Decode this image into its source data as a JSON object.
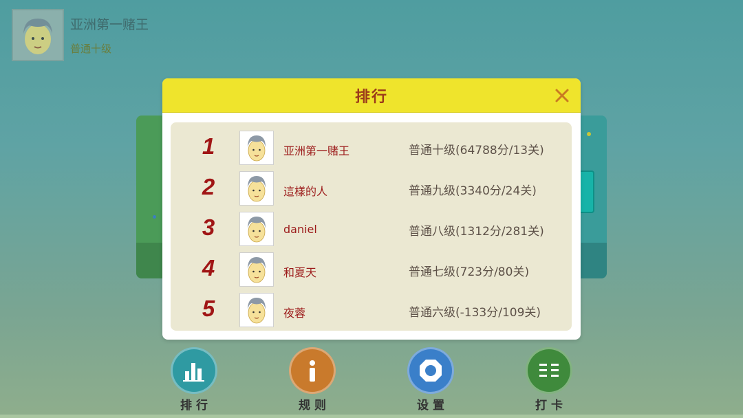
{
  "profile": {
    "name": "亚洲第一赌王",
    "level": "普通十级"
  },
  "modal": {
    "title": "排行",
    "close_icon": "close-icon"
  },
  "rankings": [
    {
      "rank": "1",
      "name": "亚洲第一赌王",
      "score": "普通十级(64788分/13关)"
    },
    {
      "rank": "2",
      "name": "這樣的人",
      "score": "普通九级(3340分/24关)"
    },
    {
      "rank": "3",
      "name": "daniel",
      "score": "普通八级(1312分/281关)"
    },
    {
      "rank": "4",
      "name": "和夏天",
      "score": "普通七级(723分/80关)"
    },
    {
      "rank": "5",
      "name": "夜蓉",
      "score": "普通六级(-133分/109关)"
    }
  ],
  "nav": [
    {
      "label": "排行",
      "icon": "bar-chart-icon",
      "color": "#2f9aa2"
    },
    {
      "label": "规则",
      "icon": "info-icon",
      "color": "#c97a2c"
    },
    {
      "label": "设置",
      "icon": "gear-icon",
      "color": "#3a7fc9"
    },
    {
      "label": "打卡",
      "icon": "checkin-icon",
      "color": "#3f8a3c"
    }
  ],
  "colors": {
    "header": "#efe42c",
    "rank_number": "#a01515",
    "name_text": "#9c1b1b"
  }
}
